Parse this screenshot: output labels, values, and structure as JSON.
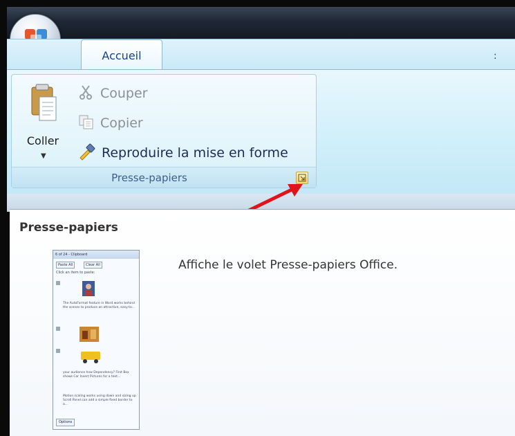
{
  "ribbon": {
    "tabs": [
      {
        "label": "Accueil"
      }
    ],
    "tab_overflow": ":",
    "group": {
      "label": "Presse-papiers",
      "paste_label": "Coller",
      "commands": [
        {
          "label": "Couper",
          "icon": "scissors-icon",
          "enabled": false
        },
        {
          "label": "Copier",
          "icon": "copy-icon",
          "enabled": false
        },
        {
          "label": "Reproduire la mise en forme",
          "icon": "format-painter-icon",
          "enabled": true
        }
      ],
      "launcher_icon": "dialog-launcher-icon"
    }
  },
  "supertip": {
    "title": "Presse-papiers",
    "description": "Affiche le volet Presse-papiers Office.",
    "thumbnail": {
      "title": "6 of 24 - Clipboard",
      "paste_all": "Paste All",
      "clear_all": "Clear All",
      "hint": "Click an item to paste:",
      "items": [
        "The AutoFormat feature in Word works behind the scenes to produce an attractive, easy-to...",
        "your audience how Dependency? First Box shows Car Insert Pictures for a text...",
        "Motion scaling works using down and sizing up Scroll Panel can add a simple fixed border to a..."
      ],
      "options": "Options"
    }
  },
  "colors": {
    "accent": "#15428b",
    "annotation_arrow": "#e0141a"
  }
}
